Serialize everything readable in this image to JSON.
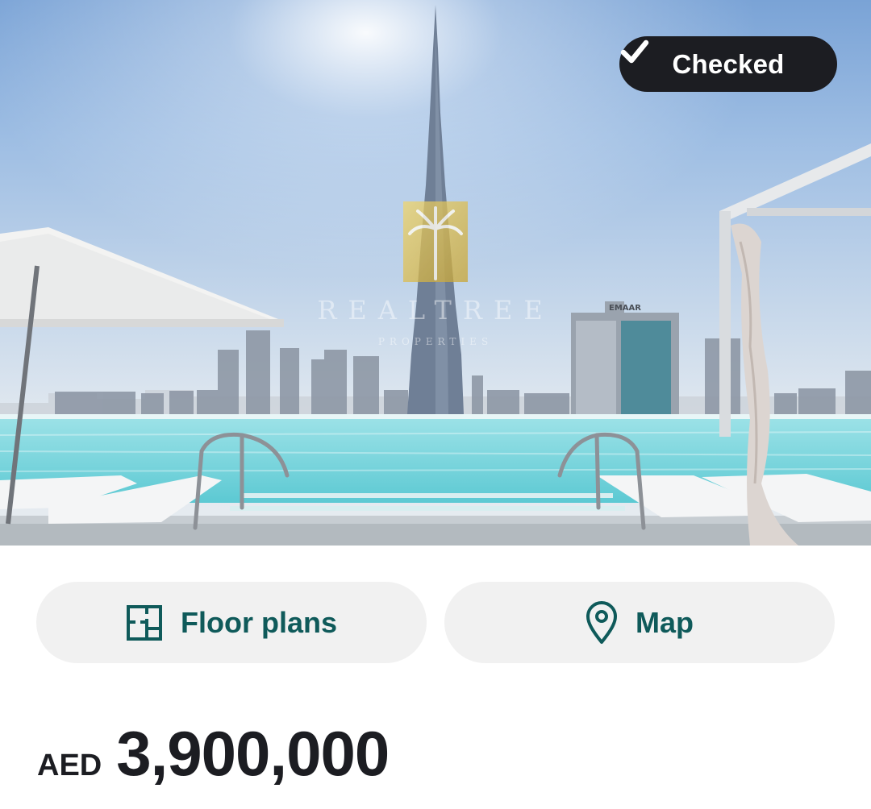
{
  "hero": {
    "badge_label": "Checked",
    "watermark_name": "REALTREE",
    "watermark_sub": "PROPERTIES",
    "tower_sign": "EMAAR"
  },
  "actions": {
    "floor_plans_label": "Floor plans",
    "map_label": "Map"
  },
  "price": {
    "currency": "AED",
    "amount": "3,900,000"
  },
  "colors": {
    "accent": "#0f5a5a",
    "badge_bg": "#1c1d22",
    "button_bg": "#f1f1f1",
    "pool_water": "#7fd8df"
  },
  "icons": {
    "badge": "check-icon",
    "floor_plans": "floor-plan-icon",
    "map": "map-pin-icon"
  }
}
